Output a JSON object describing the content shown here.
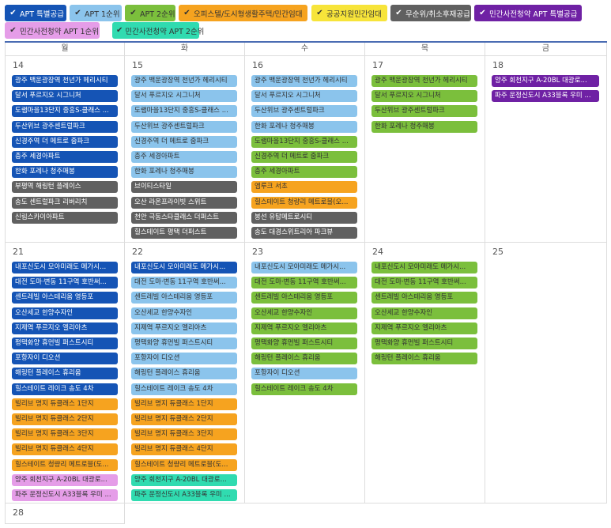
{
  "colors": {
    "darkblue": "#1554b5",
    "lightblue": "#8bc4ec",
    "green": "#7bbf3c",
    "orange": "#f6a31f",
    "yellow": "#f7e43a",
    "gray": "#606060",
    "purple": "#6f21a4",
    "pink": "#e59de8",
    "teal": "#30dbb0"
  },
  "legend": [
    {
      "label": "APT 특별공급",
      "color": "darkblue",
      "text": "#ffffff"
    },
    {
      "label": "APT 1순위",
      "color": "lightblue",
      "text": "#333333"
    },
    {
      "label": "APT 2순위",
      "color": "green",
      "text": "#333333"
    },
    {
      "label": "오피스텔/도시형생활주택/민간임대",
      "color": "orange",
      "text": "#333333"
    },
    {
      "label": "공공지원민간임대",
      "color": "yellow",
      "text": "#333333"
    },
    {
      "label": "무순위/취소후재공급",
      "color": "gray",
      "text": "#ffffff"
    },
    {
      "label": "민간사전청약 APT 특별공급",
      "color": "purple",
      "text": "#ffffff"
    },
    {
      "label": "민간사전청약 APT 1순위",
      "color": "pink",
      "text": "#333333"
    },
    {
      "label": "민간사전청약 APT 2순위",
      "color": "teal",
      "text": "#333333"
    }
  ],
  "weekdays": [
    "월",
    "화",
    "수",
    "목",
    "금"
  ],
  "weeks": [
    {
      "days": [
        {
          "date": "14",
          "events": [
            {
              "t": "광주 백운광장역 천년가 헤리시티",
              "c": "darkblue"
            },
            {
              "t": "달서 푸르지오 시그니처",
              "c": "darkblue"
            },
            {
              "t": "도램마을13단지 중흥S-클래스 ...",
              "c": "darkblue"
            },
            {
              "t": "두산위브 광주센트럴파크",
              "c": "darkblue"
            },
            {
              "t": "신경주역 더 메트로 줌파크",
              "c": "darkblue"
            },
            {
              "t": "충주 세경아파트",
              "c": "darkblue"
            },
            {
              "t": "한화 포레나 청주매봉",
              "c": "darkblue"
            },
            {
              "t": "부평역 해링턴 플레이스",
              "c": "gray"
            },
            {
              "t": "송도 센트럴파크 리버리치",
              "c": "gray"
            },
            {
              "t": "신림스카이아파트",
              "c": "gray"
            }
          ]
        },
        {
          "date": "15",
          "events": [
            {
              "t": "광주 백운광장역 천년가 헤리시티",
              "c": "lightblue"
            },
            {
              "t": "달서 푸르지오 시그니처",
              "c": "lightblue"
            },
            {
              "t": "도램마을13단지 중흥S-클래스 ...",
              "c": "lightblue"
            },
            {
              "t": "두산위브 광주센트럴파크",
              "c": "lightblue"
            },
            {
              "t": "신경주역 더 메트로 줌파크",
              "c": "lightblue"
            },
            {
              "t": "충주 세경아파트",
              "c": "lightblue"
            },
            {
              "t": "한화 포레나 청주매봉",
              "c": "lightblue"
            },
            {
              "t": "브이티스타일",
              "c": "gray"
            },
            {
              "t": "오산 라온프라이빗 스위트",
              "c": "gray"
            },
            {
              "t": "천안 극동스타클래스 더퍼스트",
              "c": "gray"
            },
            {
              "t": "힐스테이트 평택 더퍼스트",
              "c": "gray"
            }
          ]
        },
        {
          "date": "16",
          "events": [
            {
              "t": "광주 백운광장역 천년가 헤리시티",
              "c": "lightblue"
            },
            {
              "t": "달서 푸르지오 시그니처",
              "c": "lightblue"
            },
            {
              "t": "두산위브 광주센트럴파크",
              "c": "lightblue"
            },
            {
              "t": "한화 포레나 청주매봉",
              "c": "lightblue"
            },
            {
              "t": "도램마을13단지 중흥S-클래스 ...",
              "c": "green"
            },
            {
              "t": "신경주역 더 메트로 줌파크",
              "c": "green"
            },
            {
              "t": "충주 세경아파트",
              "c": "green"
            },
            {
              "t": "엠루크 서초",
              "c": "orange"
            },
            {
              "t": "힐스테이트 청량리 메트로블(오...",
              "c": "orange"
            },
            {
              "t": "봉선 유탑메트로시티",
              "c": "gray"
            },
            {
              "t": "송도 대경스위트리아 파크뷰",
              "c": "gray"
            }
          ]
        },
        {
          "date": "17",
          "events": [
            {
              "t": "광주 백운광장역 천년가 헤리시티",
              "c": "green"
            },
            {
              "t": "달서 푸르지오 시그니처",
              "c": "green"
            },
            {
              "t": "두산위브 광주센트럴파크",
              "c": "green"
            },
            {
              "t": "한화 포레나 청주매봉",
              "c": "green"
            }
          ]
        },
        {
          "date": "18",
          "events": [
            {
              "t": "양주 회천지구 A-20BL 대광로...",
              "c": "purple"
            },
            {
              "t": "파주 운정신도시 A33블록 우미 ...",
              "c": "purple"
            }
          ]
        }
      ]
    },
    {
      "days": [
        {
          "date": "21",
          "events": [
            {
              "t": "내포신도시 모아미래도 메가시...",
              "c": "darkblue"
            },
            {
              "t": "대전 도마·변동 11구역 호반써...",
              "c": "darkblue"
            },
            {
              "t": "센트레빌 아스테리움 영등포",
              "c": "darkblue"
            },
            {
              "t": "오산세교 한양수자인",
              "c": "darkblue"
            },
            {
              "t": "지제역 푸르지오 엘리아츠",
              "c": "darkblue"
            },
            {
              "t": "평택화양 휴먼빌 퍼스트시티",
              "c": "darkblue"
            },
            {
              "t": "포항자이 디오션",
              "c": "darkblue"
            },
            {
              "t": "해링턴 플레이스 휴리움",
              "c": "darkblue"
            },
            {
              "t": "힐스테이트 레이크 송도 4차",
              "c": "darkblue"
            },
            {
              "t": "빌리브 명지 듀클래스 1단지",
              "c": "orange"
            },
            {
              "t": "빌리브 명지 듀클래스 2단지",
              "c": "orange"
            },
            {
              "t": "빌리브 명지 듀클래스 3단지",
              "c": "orange"
            },
            {
              "t": "빌리브 명지 듀클래스 4단지",
              "c": "orange"
            },
            {
              "t": "힐스테이트 청량리 메트로블(도...",
              "c": "orange"
            },
            {
              "t": "양주 회천지구 A-20BL 대광로...",
              "c": "pink"
            },
            {
              "t": "파주 운정신도시 A33블록 우미 ...",
              "c": "pink"
            }
          ]
        },
        {
          "date": "22",
          "events": [
            {
              "t": "내포신도시 모아미래도 메가시...",
              "c": "darkblue"
            },
            {
              "t": "대전 도마·변동 11구역 호반써...",
              "c": "lightblue"
            },
            {
              "t": "센트레빌 아스테리움 영등포",
              "c": "lightblue"
            },
            {
              "t": "오산세교 한양수자인",
              "c": "lightblue"
            },
            {
              "t": "지제역 푸르지오 엘리아츠",
              "c": "lightblue"
            },
            {
              "t": "평택화양 휴먼빌 퍼스트시티",
              "c": "lightblue"
            },
            {
              "t": "포항자이 디오션",
              "c": "lightblue"
            },
            {
              "t": "해링턴 플레이스 휴리움",
              "c": "lightblue"
            },
            {
              "t": "힐스테이트 레이크 송도 4차",
              "c": "lightblue"
            },
            {
              "t": "빌리브 명지 듀클래스 1단지",
              "c": "orange"
            },
            {
              "t": "빌리브 명지 듀클래스 2단지",
              "c": "orange"
            },
            {
              "t": "빌리브 명지 듀클래스 3단지",
              "c": "orange"
            },
            {
              "t": "빌리브 명지 듀클래스 4단지",
              "c": "orange"
            },
            {
              "t": "힐스테이트 청량리 메트로블(도...",
              "c": "orange"
            },
            {
              "t": "양주 회천지구 A-20BL 대광로...",
              "c": "teal"
            },
            {
              "t": "파주 운정신도시 A33블록 우미 ...",
              "c": "teal"
            }
          ]
        },
        {
          "date": "23",
          "events": [
            {
              "t": "내포신도시 모아미래도 메가시...",
              "c": "lightblue"
            },
            {
              "t": "대전 도마·변동 11구역 호반써...",
              "c": "green"
            },
            {
              "t": "센트레빌 아스테리움 영등포",
              "c": "green"
            },
            {
              "t": "오산세교 한양수자인",
              "c": "green"
            },
            {
              "t": "지제역 푸르지오 엘리아츠",
              "c": "green"
            },
            {
              "t": "평택화양 휴먼빌 퍼스트시티",
              "c": "green"
            },
            {
              "t": "해링턴 플레이스 휴리움",
              "c": "green"
            },
            {
              "t": "포항자이 디오션",
              "c": "lightblue"
            },
            {
              "t": "힐스테이트 레이크 송도 4차",
              "c": "green"
            }
          ]
        },
        {
          "date": "24",
          "events": [
            {
              "t": "내포신도시 모아미래도 메가시...",
              "c": "green"
            },
            {
              "t": "대전 도마·변동 11구역 호반써...",
              "c": "green"
            },
            {
              "t": "센트레빌 아스테리움 영등포",
              "c": "green"
            },
            {
              "t": "오산세교 한양수자인",
              "c": "green"
            },
            {
              "t": "지제역 푸르지오 엘리아츠",
              "c": "green"
            },
            {
              "t": "평택화양 휴먼빌 퍼스트시티",
              "c": "green"
            },
            {
              "t": "해링턴 플레이스 휴리움",
              "c": "green"
            }
          ]
        },
        {
          "date": "25",
          "events": []
        }
      ]
    },
    {
      "days": [
        {
          "date": "28",
          "events": []
        }
      ]
    }
  ]
}
